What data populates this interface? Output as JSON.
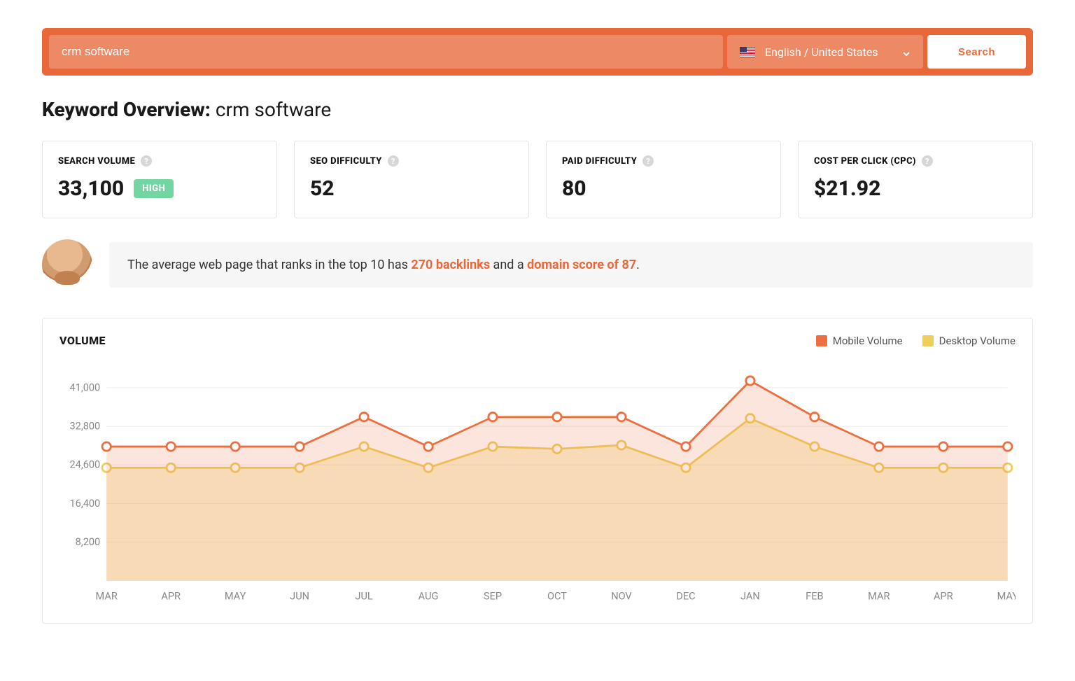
{
  "search": {
    "query": "crm software",
    "locale_label": "English / United States",
    "button_label": "Search"
  },
  "overview": {
    "title_prefix": "Keyword Overview: ",
    "keyword": "crm software"
  },
  "metrics": {
    "search_volume": {
      "label": "SEARCH VOLUME",
      "value": "33,100",
      "badge": "HIGH"
    },
    "seo_difficulty": {
      "label": "SEO DIFFICULTY",
      "value": "52"
    },
    "paid_difficulty": {
      "label": "PAID DIFFICULTY",
      "value": "80"
    },
    "cpc": {
      "label": "COST PER CLICK (CPC)",
      "value": "$21.92"
    }
  },
  "tip": {
    "pre": "The average web page that ranks in the top 10 has ",
    "backlinks": "270 backlinks",
    "mid": " and a ",
    "domain_score": "domain score of 87",
    "post": "."
  },
  "chart": {
    "title": "VOLUME",
    "legend": {
      "mobile": "Mobile Volume",
      "desktop": "Desktop Volume"
    }
  },
  "chart_data": {
    "type": "line",
    "title": "VOLUME",
    "xlabel": "",
    "ylabel": "",
    "categories": [
      "MAR",
      "APR",
      "MAY",
      "JUN",
      "JUL",
      "AUG",
      "SEP",
      "OCT",
      "NOV",
      "DEC",
      "JAN",
      "FEB",
      "MAR",
      "APR",
      "MAY"
    ],
    "y_ticks": [
      8200,
      16400,
      24600,
      32800,
      41000
    ],
    "ylim": [
      0,
      45000
    ],
    "series": [
      {
        "name": "Mobile Volume",
        "color": "#ed6f3f",
        "values": [
          28500,
          28500,
          28500,
          28500,
          34800,
          28500,
          34800,
          34800,
          34800,
          28500,
          42500,
          34800,
          28500,
          28500,
          28500
        ]
      },
      {
        "name": "Desktop Volume",
        "color": "#eecf5c",
        "values": [
          24000,
          24000,
          24000,
          24000,
          28500,
          24000,
          28500,
          28000,
          28800,
          24000,
          34500,
          28500,
          24000,
          24000,
          24000
        ]
      }
    ]
  }
}
